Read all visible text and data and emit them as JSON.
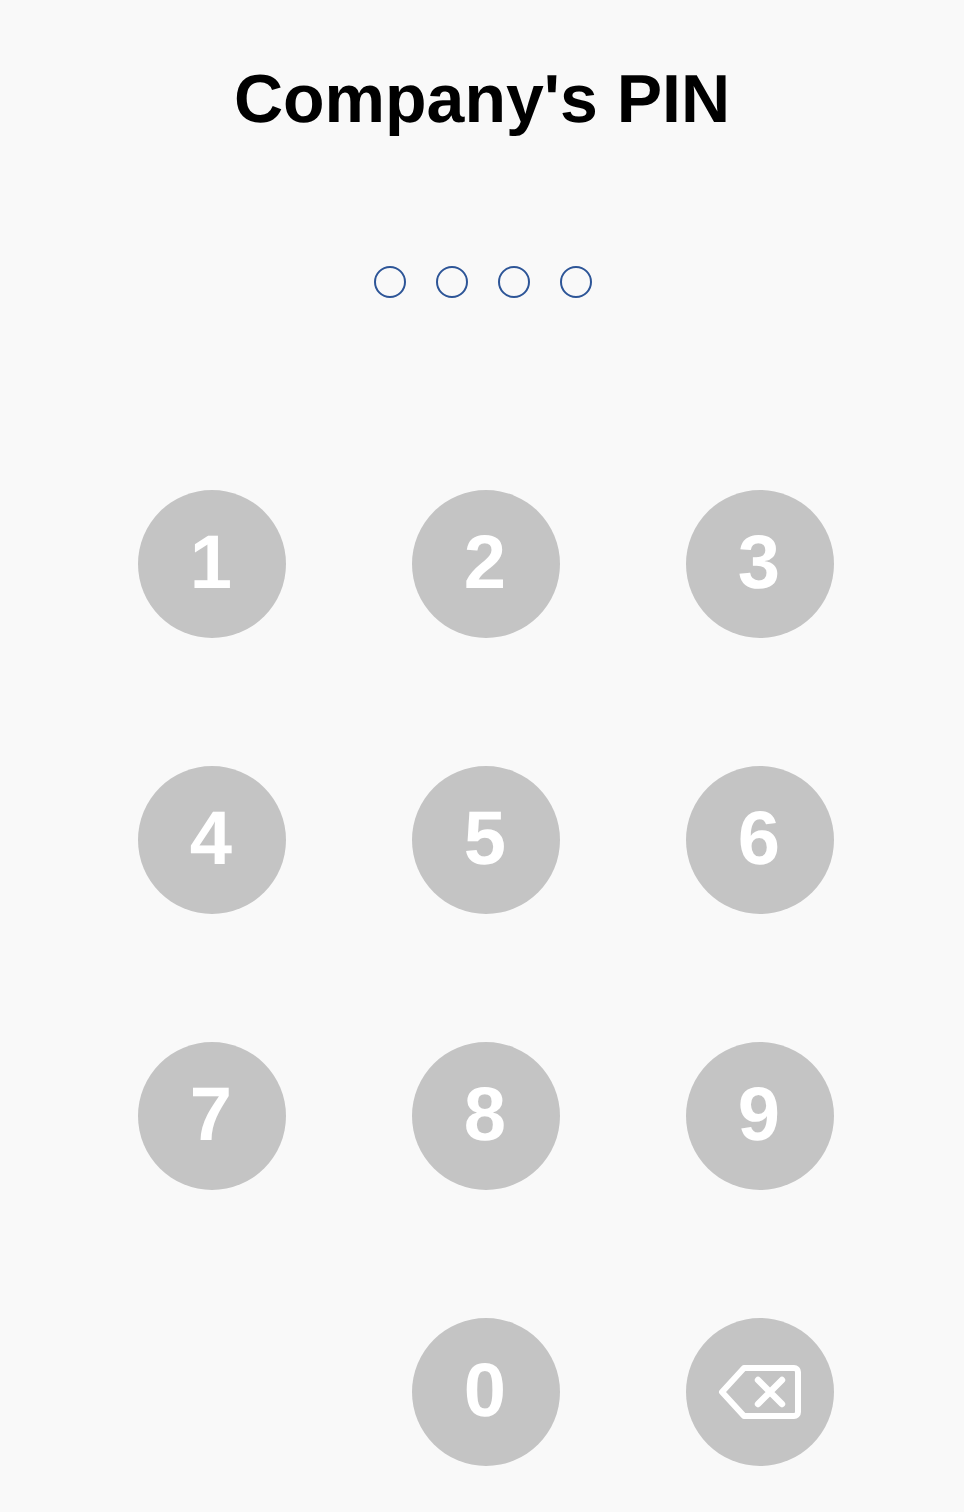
{
  "title": "Company's PIN",
  "pin_dots": [
    {
      "filled": false
    },
    {
      "filled": false
    },
    {
      "filled": false
    },
    {
      "filled": false
    }
  ],
  "keypad": [
    {
      "kind": "digit",
      "label": "1"
    },
    {
      "kind": "digit",
      "label": "2"
    },
    {
      "kind": "digit",
      "label": "3"
    },
    {
      "kind": "digit",
      "label": "4"
    },
    {
      "kind": "digit",
      "label": "5"
    },
    {
      "kind": "digit",
      "label": "6"
    },
    {
      "kind": "digit",
      "label": "7"
    },
    {
      "kind": "digit",
      "label": "8"
    },
    {
      "kind": "digit",
      "label": "9"
    },
    {
      "kind": "blank"
    },
    {
      "kind": "digit",
      "label": "0"
    },
    {
      "kind": "backspace"
    }
  ]
}
